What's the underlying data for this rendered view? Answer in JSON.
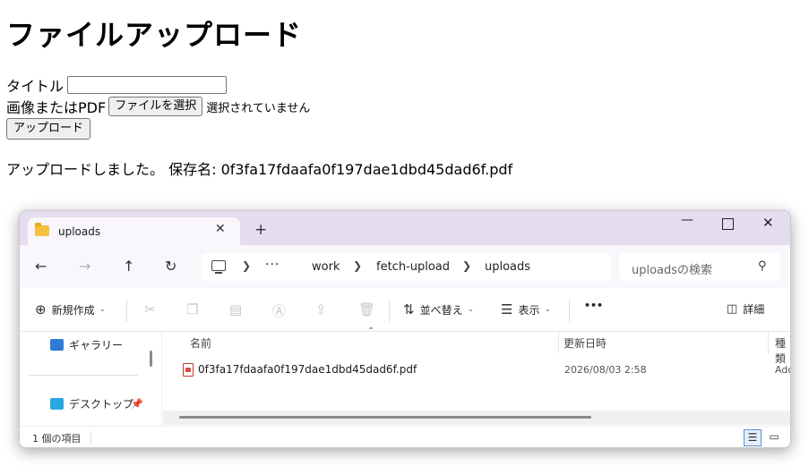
{
  "page": {
    "heading": "ファイルアップロード",
    "title_label": "タイトル",
    "title_value": "",
    "file_label": "画像またはPDF",
    "file_button": "ファイルを選択",
    "file_status": "選択されていません",
    "upload_button": "アップロード",
    "result_message": "アップロードしました。 保存名: 0f3fa17fdaafa0f197dae1dbd45dad6f.pdf"
  },
  "explorer": {
    "tab_title": "uploads",
    "tab_close": "✕",
    "new_tab": "+",
    "breadcrumb": [
      "work",
      "fetch-upload",
      "uploads"
    ],
    "search_placeholder": "uploadsの検索",
    "toolbar": {
      "new": "新規作成",
      "sort": "並べ替え",
      "view": "表示",
      "more": "•••",
      "details": "詳細"
    },
    "sidebar": {
      "gallery": "ギャラリー",
      "desktop": "デスクトップ"
    },
    "columns": {
      "name": "名前",
      "modified": "更新日時",
      "type": "種類"
    },
    "files": [
      {
        "name": "0f3fa17fdaafa0f197dae1dbd45dad6f.pdf",
        "modified": "2026/08/03 2:58",
        "type": "Ado"
      }
    ],
    "status": "1 個の項目"
  }
}
